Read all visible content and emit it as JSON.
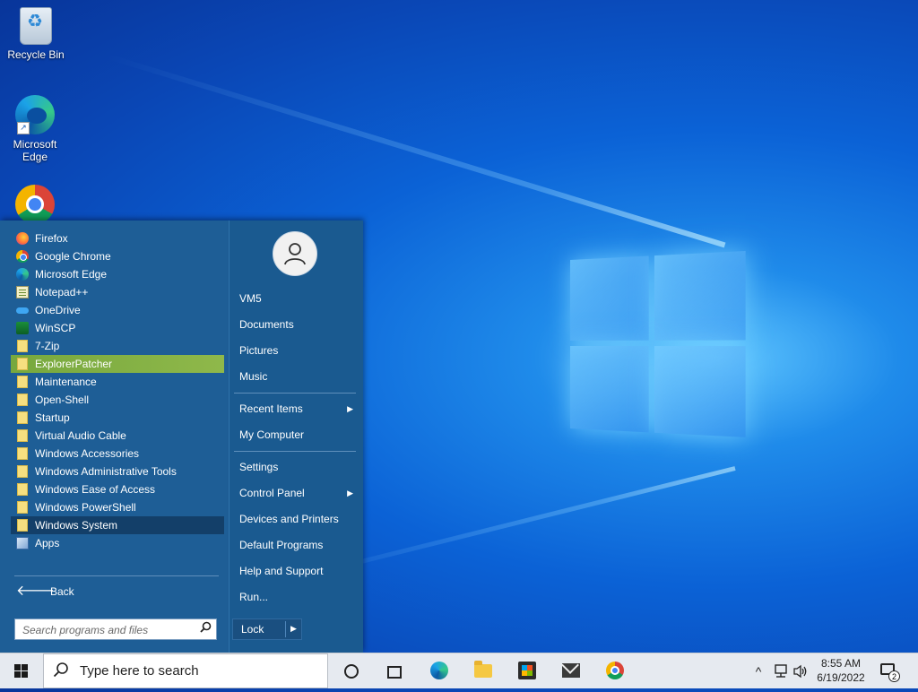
{
  "desktop": {
    "icons": [
      {
        "label": "Recycle Bin",
        "icon": "recycle-bin-icon"
      },
      {
        "label": "Microsoft\nEdge",
        "icon": "edge-icon"
      },
      {
        "label": "",
        "icon": "chrome-icon"
      }
    ]
  },
  "start_menu": {
    "programs": [
      {
        "label": "Firefox",
        "icon": "firefox-icon"
      },
      {
        "label": "Google Chrome",
        "icon": "chrome-icon"
      },
      {
        "label": "Microsoft Edge",
        "icon": "edge-icon"
      },
      {
        "label": "Notepad++",
        "icon": "notepad-icon"
      },
      {
        "label": "OneDrive",
        "icon": "onedrive-icon"
      },
      {
        "label": "WinSCP",
        "icon": "winscp-icon"
      },
      {
        "label": "7-Zip",
        "icon": "folder-icon"
      },
      {
        "label": "ExplorerPatcher",
        "icon": "folder-icon"
      },
      {
        "label": "Maintenance",
        "icon": "folder-icon"
      },
      {
        "label": "Open-Shell",
        "icon": "folder-icon"
      },
      {
        "label": "Startup",
        "icon": "folder-icon"
      },
      {
        "label": "Virtual Audio Cable",
        "icon": "folder-icon"
      },
      {
        "label": "Windows Accessories",
        "icon": "folder-icon"
      },
      {
        "label": "Windows Administrative Tools",
        "icon": "folder-icon"
      },
      {
        "label": "Windows Ease of Access",
        "icon": "folder-icon"
      },
      {
        "label": "Windows PowerShell",
        "icon": "folder-icon"
      },
      {
        "label": "Windows System",
        "icon": "folder-icon"
      },
      {
        "label": "Apps",
        "icon": "apps-icon"
      }
    ],
    "highlighted": "ExplorerPatcher",
    "selected": "Windows System",
    "back_label": "Back",
    "search_placeholder": "Search programs and files",
    "user": {
      "icon": "user-avatar-icon"
    },
    "right_items": [
      {
        "label": "VM5"
      },
      {
        "label": "Documents"
      },
      {
        "label": "Pictures"
      },
      {
        "label": "Music"
      },
      {
        "label": "Recent Items",
        "submenu": true
      },
      {
        "label": "My Computer"
      },
      {
        "label": "Settings"
      },
      {
        "label": "Control Panel",
        "submenu": true
      },
      {
        "label": "Devices and Printers"
      },
      {
        "label": "Default Programs"
      },
      {
        "label": "Help and Support"
      },
      {
        "label": "Run..."
      }
    ],
    "lock_label": "Lock",
    "submenu_caret": "▶"
  },
  "taskbar": {
    "search_placeholder": "Type here to search",
    "pinned": [
      "cortana-icon",
      "task-view-icon",
      "edge-icon",
      "file-explorer-icon",
      "store-icon",
      "mail-icon",
      "chrome-icon"
    ],
    "tray": {
      "chevron": "^",
      "time": "8:55 AM",
      "date": "6/19/2022",
      "notification_count": "2"
    }
  },
  "colors": {
    "menu_bg": "#1e5e96",
    "highlight": "#8fb84a",
    "selected": "#133f69",
    "taskbar_bg": "#e6eaf0"
  }
}
